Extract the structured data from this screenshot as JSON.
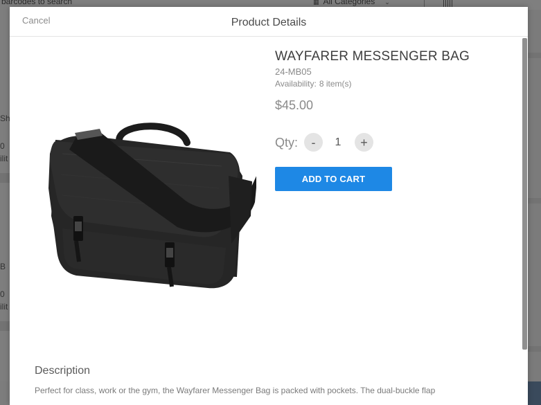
{
  "background": {
    "search_placeholder": "barcodes to search",
    "category_select": "All Categories",
    "left_fragments": [
      "Sh",
      "0",
      "ilit",
      "B",
      "0",
      "ilit"
    ]
  },
  "modal": {
    "cancel_label": "Cancel",
    "title": "Product Details"
  },
  "product": {
    "name": "WAYFARER MESSENGER BAG",
    "sku": "24-MB05",
    "availability_label": "Availability:",
    "availability_value": "8 item(s)",
    "price": "$45.00",
    "image_icon": "messenger-bag-image"
  },
  "quantity": {
    "label": "Qty:",
    "minus": "-",
    "value": "1",
    "plus": "+"
  },
  "actions": {
    "add_to_cart": "ADD TO CART"
  },
  "description": {
    "heading": "Description",
    "text": "Perfect for class, work or the gym, the Wayfarer Messenger Bag is packed with pockets. The dual-buckle flap"
  },
  "colors": {
    "accent": "#1e88e5",
    "text_primary": "#3d3d3d",
    "text_muted": "#8a8a8a"
  }
}
